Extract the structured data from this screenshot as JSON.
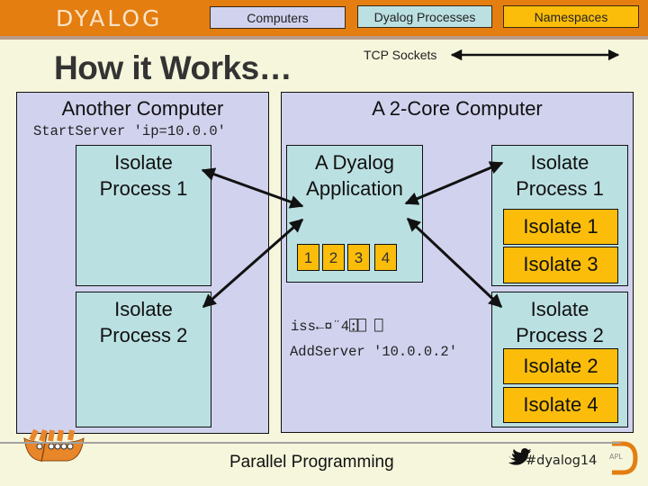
{
  "header": {
    "logo_text": "DYALOG",
    "legend": [
      {
        "label": "Computers",
        "color": "#d1d2ee"
      },
      {
        "label": "Dyalog Processes",
        "color": "#bbe0e2"
      },
      {
        "label": "Namespaces",
        "color": "#fbbd0a"
      }
    ],
    "bar_color": "#e47e10"
  },
  "slide": {
    "title": "How it Works…",
    "tcp_label": "TCP Sockets"
  },
  "another_computer": {
    "title": "Another Computer",
    "code": "StartServer 'ip=10.0.0'",
    "processes": [
      {
        "title_line1": "Isolate",
        "title_line2": "Process 1"
      },
      {
        "title_line1": "Isolate",
        "title_line2": "Process 2"
      }
    ]
  },
  "two_core_computer": {
    "title": "A 2-Core Computer",
    "application": {
      "title_line1": "A Dyalog",
      "title_line2": "Application",
      "cores": [
        "1",
        "2",
        "3",
        "4"
      ]
    },
    "code_lines": [
      "iss←¤¨4⍠⎕ ⎕",
      "AddServer '10.0.0.2'"
    ],
    "processes": [
      {
        "title_line1": "Isolate",
        "title_line2": "Process 1",
        "isolates": [
          "Isolate 1",
          "Isolate 3"
        ]
      },
      {
        "title_line1": "Isolate",
        "title_line2": "Process 2",
        "isolates": [
          "Isolate 2",
          "Isolate 4"
        ]
      }
    ]
  },
  "footer": {
    "title": "Parallel Programming",
    "hashtag": "#dyalog14",
    "apl_badge": "APL",
    "viking_badge": "ʘ ʘʘʘʘ"
  }
}
